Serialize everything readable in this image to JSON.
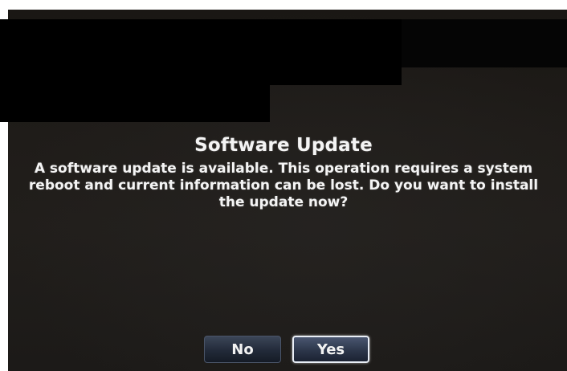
{
  "dialog": {
    "title": "Software Update",
    "message": "A software update is available. This operation requires a system reboot and current information can be lost. Do you want to install the update now?",
    "buttons": {
      "no_label": "No",
      "yes_label": "Yes"
    }
  },
  "colors": {
    "screen_background": "#1f1c19",
    "text": "#f4f4f4",
    "button_background": "#222a39",
    "selected_button_border": "#e9eef6",
    "redaction": "#000000"
  }
}
